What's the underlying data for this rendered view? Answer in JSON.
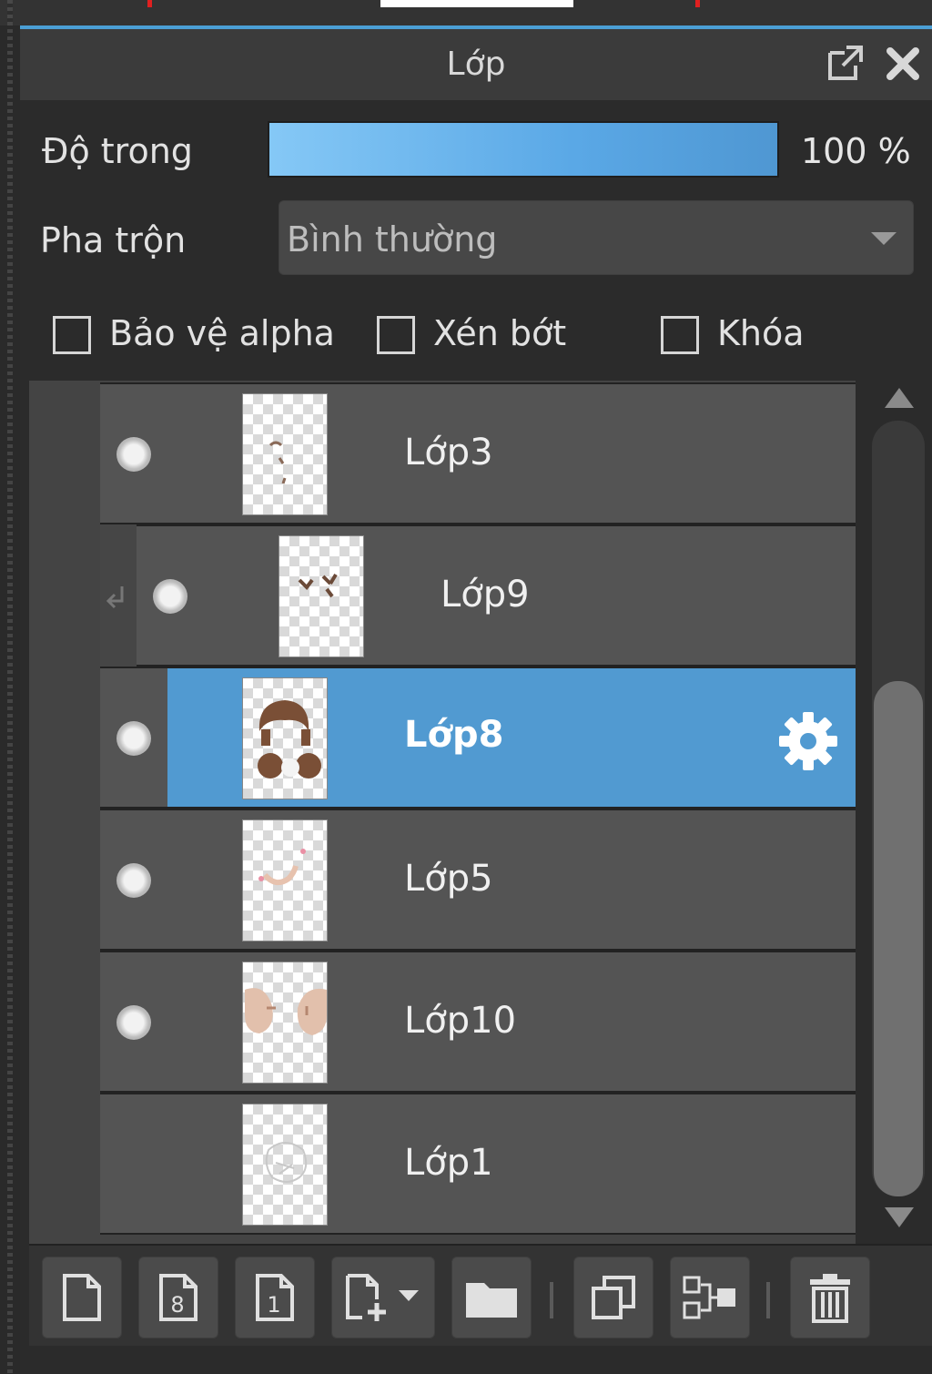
{
  "panel": {
    "title": "Lớp",
    "popout_icon": "external-window-icon",
    "close_icon": "close-icon"
  },
  "opacity": {
    "label": "Độ trong",
    "value": "100 %",
    "level": 1.0
  },
  "blend": {
    "label": "Pha trộn",
    "value": "Bình thường"
  },
  "options": {
    "protect_alpha": {
      "label": "Bảo vệ alpha",
      "checked": false
    },
    "clipping": {
      "label": "Xén bớt",
      "checked": false
    },
    "lock": {
      "label": "Khóa",
      "checked": false
    }
  },
  "layers": [
    {
      "name": "Lớp3",
      "visible": true,
      "selected": false,
      "clipped": false
    },
    {
      "name": "Lớp9",
      "visible": true,
      "selected": false,
      "clipped": true
    },
    {
      "name": "Lớp8",
      "visible": true,
      "selected": true,
      "clipped": false,
      "settings_icon": "gear-icon"
    },
    {
      "name": "Lớp5",
      "visible": true,
      "selected": false,
      "clipped": false
    },
    {
      "name": "Lớp10",
      "visible": true,
      "selected": false,
      "clipped": false
    },
    {
      "name": "Lớp1",
      "visible": false,
      "selected": false,
      "clipped": false
    }
  ],
  "toolbar": {
    "buttons": [
      "new-layer-icon",
      "new-8bit-layer-icon",
      "new-1bit-layer-icon",
      "add-layer-dropdown-icon",
      "new-folder-icon",
      "duplicate-layer-icon",
      "merge-layer-icon",
      "delete-layer-icon"
    ]
  },
  "colors": {
    "accent": "#519ad1",
    "panel": "#2b2b2b",
    "row": "#545454"
  }
}
